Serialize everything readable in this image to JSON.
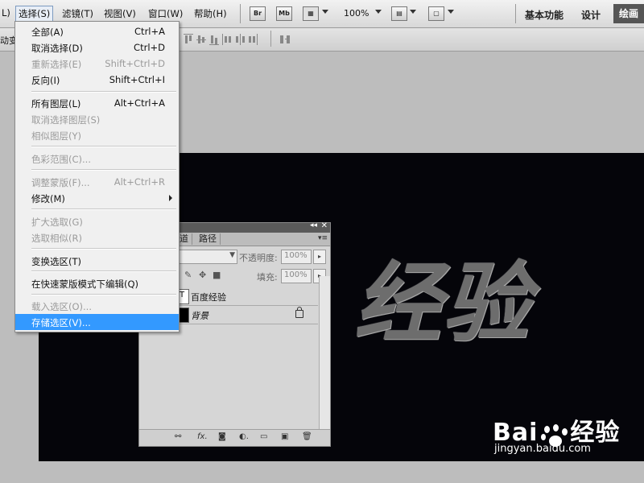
{
  "menubar": {
    "items": [
      "L)",
      "选择(S)",
      "滤镜(T)",
      "视图(V)",
      "窗口(W)",
      "帮助(H)"
    ],
    "bridge": "Br",
    "minibridge": "Mb",
    "zoom": "100%",
    "workspaces": [
      "基本功能",
      "设计"
    ],
    "active_workspace": "绘画"
  },
  "optionsbar": {
    "left_fragment": "动变接"
  },
  "select_menu": {
    "items": [
      {
        "label": "全部(A)",
        "shortcut": "Ctrl+A"
      },
      {
        "label": "取消选择(D)",
        "shortcut": "Ctrl+D"
      },
      {
        "label": "重新选择(E)",
        "shortcut": "Shift+Ctrl+D"
      },
      {
        "label": "反向(I)",
        "shortcut": "Shift+Ctrl+I"
      },
      {
        "label": "所有图层(L)",
        "shortcut": "Alt+Ctrl+A"
      },
      {
        "label": "取消选择图层(S)",
        "shortcut": ""
      },
      {
        "label": "相似图层(Y)",
        "shortcut": ""
      },
      {
        "label": "色彩范围(C)...",
        "shortcut": ""
      },
      {
        "label": "调整蒙版(F)...",
        "shortcut": "Alt+Ctrl+R"
      },
      {
        "label": "修改(M)",
        "shortcut": ""
      },
      {
        "label": "扩大选取(G)",
        "shortcut": ""
      },
      {
        "label": "选取相似(R)",
        "shortcut": ""
      },
      {
        "label": "变换选区(T)",
        "shortcut": ""
      },
      {
        "label": "在快速蒙版模式下编辑(Q)",
        "shortcut": ""
      },
      {
        "label": "载入选区(O)...",
        "shortcut": ""
      },
      {
        "label": "存储选区(V)...",
        "shortcut": ""
      }
    ]
  },
  "canvas": {
    "text": "经验"
  },
  "layers_panel": {
    "tabs": [
      "道",
      "路径"
    ],
    "opacity_label": "不透明度:",
    "opacity_value": "100%",
    "fill_label": "填充:",
    "fill_value": "100%",
    "layers": [
      {
        "name": "百度经验"
      },
      {
        "name": "背景"
      }
    ],
    "bottom_icons": [
      "link-icon",
      "fx-icon",
      "mask-icon",
      "adjustment-icon",
      "folder-icon",
      "new-layer-icon",
      "trash-icon"
    ]
  },
  "watermark": {
    "brand": "Bai",
    "brand2": "经验",
    "url": "jingyan.baidu.com"
  }
}
